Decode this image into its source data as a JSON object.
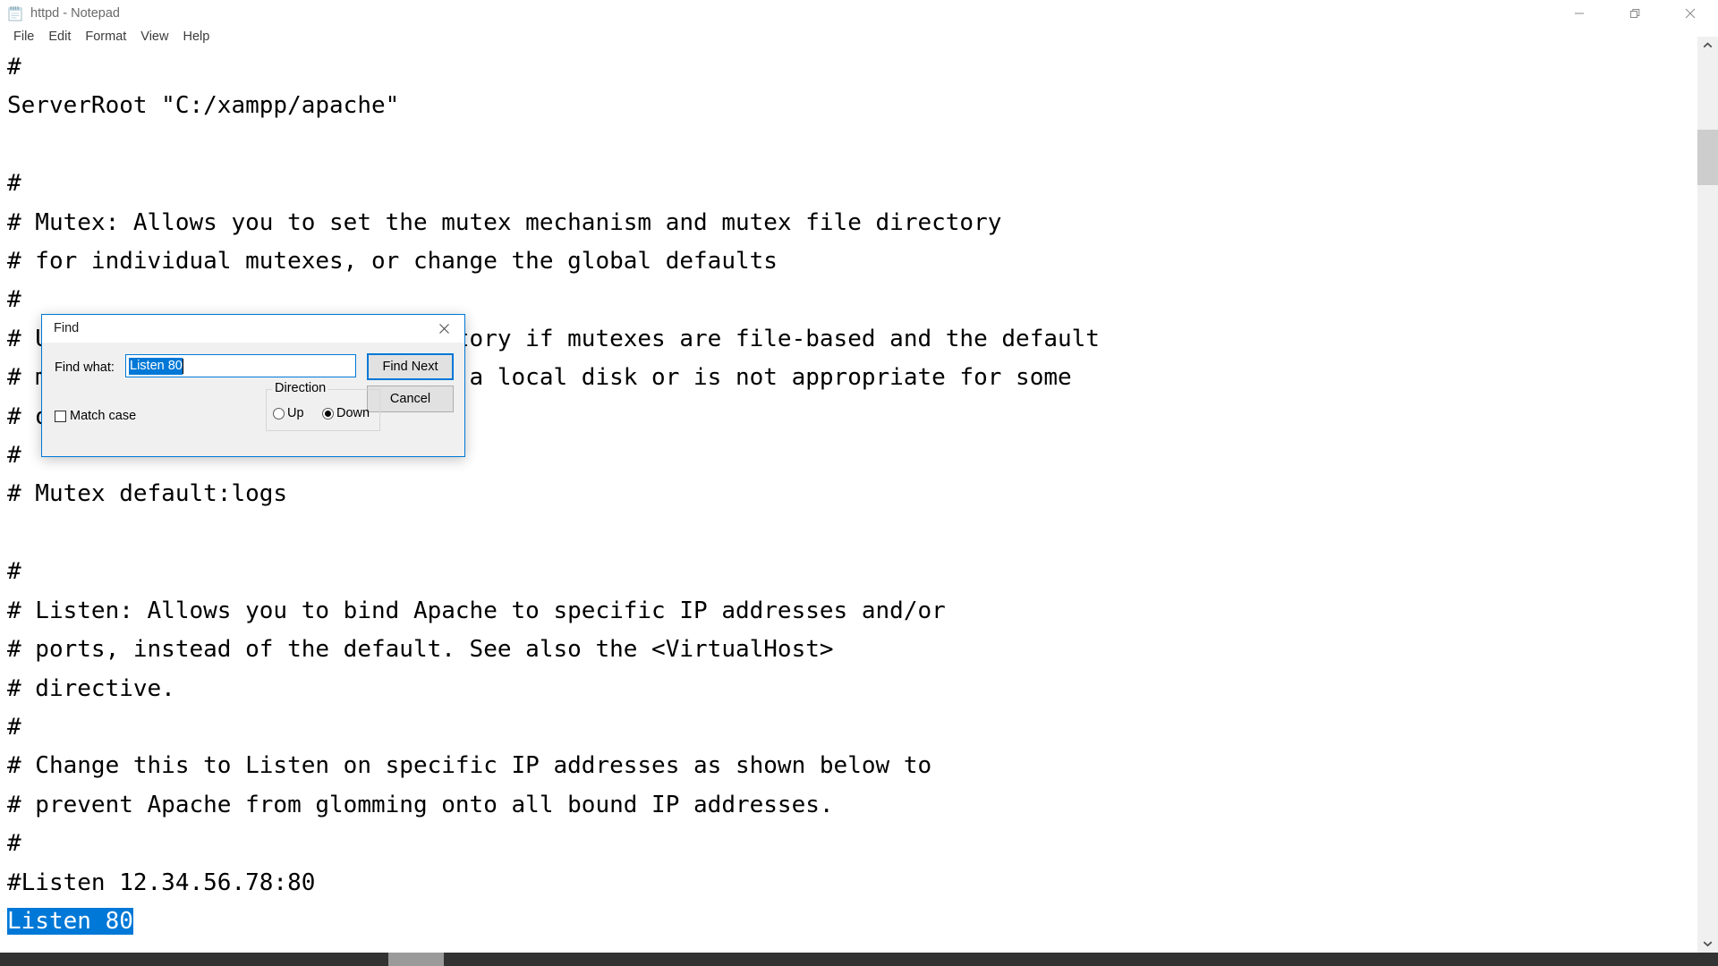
{
  "window": {
    "title": "httpd - Notepad",
    "icon": "notepad-icon",
    "controls": {
      "minimize": "minimize-icon",
      "maximize": "restore-icon",
      "close": "close-icon"
    }
  },
  "menubar": {
    "items": [
      {
        "label": "File"
      },
      {
        "label": "Edit"
      },
      {
        "label": "Format"
      },
      {
        "label": "View"
      },
      {
        "label": "Help"
      }
    ]
  },
  "editor": {
    "lines": [
      "#",
      "ServerRoot \"C:/xampp/apache\"",
      "",
      "#",
      "# Mutex: Allows you to set the mutex mechanism and mutex file directory",
      "# for individual mutexes, or change the global defaults",
      "#",
      "# Uncomment and change the directory if mutexes are file-based and the default",
      "# mutex file directory is not on a local disk or is not appropriate for some",
      "# other reason.",
      "#",
      "# Mutex default:logs",
      "",
      "#",
      "# Listen: Allows you to bind Apache to specific IP addresses and/or",
      "# ports, instead of the default. See also the <VirtualHost>",
      "# directive.",
      "#",
      "# Change this to Listen on specific IP addresses as shown below to",
      "# prevent Apache from glomming onto all bound IP addresses.",
      "#",
      "#Listen 12.34.56.78:80"
    ],
    "selected_line": "Listen 80",
    "selection_color": "#0078d7"
  },
  "find_dialog": {
    "title": "Find",
    "close_icon": "close-icon",
    "find_what_label": "Find what:",
    "find_what_value": "Listen 80",
    "find_what_placeholder": "",
    "buttons": {
      "find_next": "Find Next",
      "cancel": "Cancel"
    },
    "direction": {
      "group_label": "Direction",
      "options": [
        {
          "label": "Up",
          "selected": false
        },
        {
          "label": "Down",
          "selected": true
        }
      ]
    },
    "match_case": {
      "label": "Match case",
      "checked": false
    },
    "accent_color": "#0078d7"
  },
  "scrollbars": {
    "vertical": {
      "up_arrow": "chevron-up-icon",
      "down_arrow": "chevron-down-icon"
    },
    "horizontal": {
      "present": true
    }
  }
}
